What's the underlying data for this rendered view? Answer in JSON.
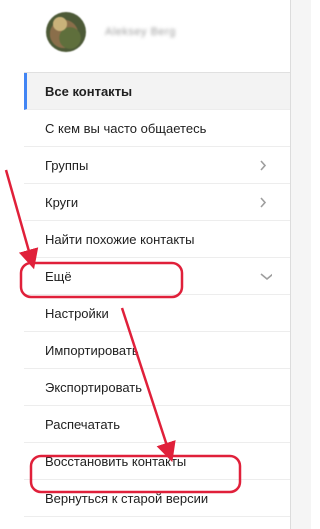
{
  "user": {
    "name": "Aleksey Berg"
  },
  "menu": {
    "items": [
      {
        "label": "Все контакты"
      },
      {
        "label": "С кем вы часто общаетесь"
      },
      {
        "label": "Группы"
      },
      {
        "label": "Круги"
      },
      {
        "label": "Найти похожие контакты"
      },
      {
        "label": "Ещё"
      },
      {
        "label": "Настройки"
      },
      {
        "label": "Импортировать"
      },
      {
        "label": "Экспортировать"
      },
      {
        "label": "Распечатать"
      },
      {
        "label": "Восстановить контакты"
      },
      {
        "label": "Вернуться к старой версии"
      }
    ]
  },
  "colors": {
    "accent": "#4285f4",
    "annotation": "#e0203a"
  }
}
